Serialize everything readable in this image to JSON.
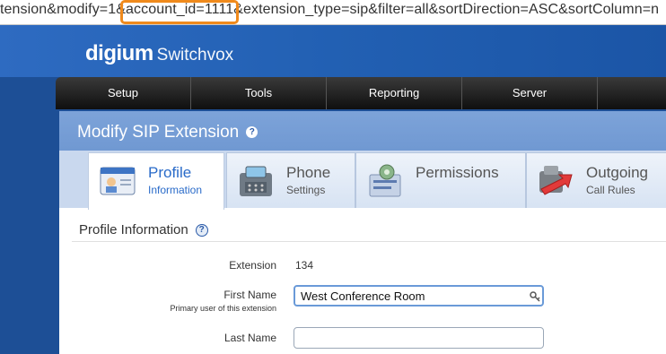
{
  "url": "tension&modify=1&account_id=1111&extension_type=sip&filter=all&sortDirection=ASC&sortColumn=n",
  "brand": {
    "name": "digium",
    "product": "Switchvox"
  },
  "nav": [
    {
      "label": "Setup"
    },
    {
      "label": "Tools"
    },
    {
      "label": "Reporting"
    },
    {
      "label": "Server"
    }
  ],
  "page_title": "Modify SIP Extension",
  "help_glyph": "?",
  "tabs": [
    {
      "title": "Profile",
      "subtitle": "Information",
      "icon": "profile-card-icon",
      "active": true
    },
    {
      "title": "Phone",
      "subtitle": "Settings",
      "icon": "desk-phone-icon"
    },
    {
      "title": "Permissions",
      "subtitle": "",
      "icon": "permissions-icon"
    },
    {
      "title": "Outgoing",
      "subtitle": "Call Rules",
      "icon": "outgoing-arrow-icon"
    }
  ],
  "section_title": "Profile Information",
  "fields": {
    "extension": {
      "label": "Extension",
      "value": "134"
    },
    "first_name": {
      "label": "First Name",
      "sublabel": "Primary user of this extension",
      "value": "West Conference Room"
    },
    "last_name": {
      "label": "Last Name",
      "value": ""
    }
  },
  "colors": {
    "highlight": "#f08a1c",
    "header_blue": "#2260b3",
    "active_tab_text": "#2a6bc9"
  }
}
